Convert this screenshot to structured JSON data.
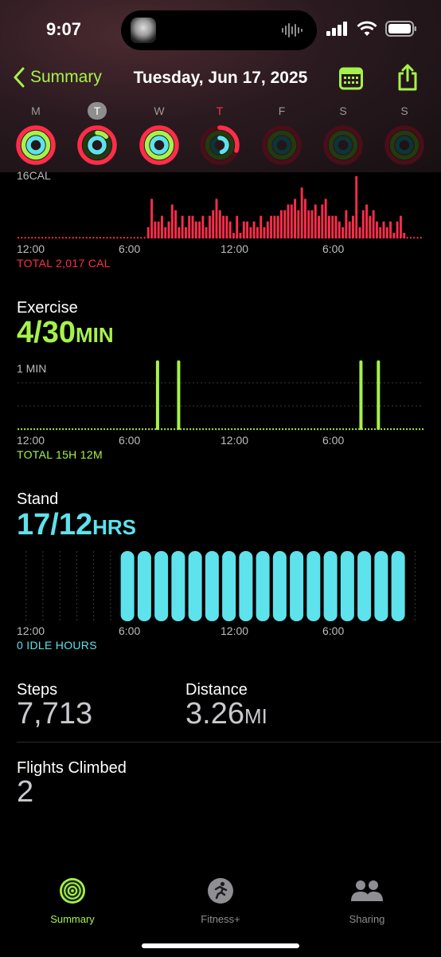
{
  "status_bar": {
    "time": "9:07"
  },
  "nav": {
    "back_label": "Summary",
    "title": "Tuesday, Jun 17, 2025"
  },
  "week": [
    {
      "letter": "M",
      "state": "normal",
      "move": 1.0,
      "exercise": 1.0,
      "stand": 1.0
    },
    {
      "letter": "T",
      "state": "selected",
      "move": 1.0,
      "exercise": 0.13,
      "stand": 1.0
    },
    {
      "letter": "W",
      "state": "normal",
      "move": 1.0,
      "exercise": 1.0,
      "stand": 1.0
    },
    {
      "letter": "T",
      "state": "today",
      "move": 0.3,
      "exercise": 0.0,
      "stand": 0.45
    },
    {
      "letter": "F",
      "state": "normal",
      "move": 0,
      "exercise": 0,
      "stand": 0
    },
    {
      "letter": "S",
      "state": "normal",
      "move": 0,
      "exercise": 0,
      "stand": 0
    },
    {
      "letter": "S",
      "state": "normal",
      "move": 0,
      "exercise": 0,
      "stand": 0
    }
  ],
  "move": {
    "y_max_label": "16CAL",
    "total": "TOTAL 2,017 CAL",
    "color": "#ff2d4a",
    "ticks": [
      "12:00",
      "6:00",
      "12:00",
      "6:00"
    ],
    "bars": [
      0,
      0,
      0,
      0,
      0,
      0,
      0,
      0,
      0,
      0,
      0,
      0,
      0,
      0,
      0,
      0,
      0,
      0,
      0,
      0,
      0,
      0,
      0,
      0,
      0,
      0,
      0,
      0,
      0,
      0,
      0,
      0,
      0,
      0,
      0,
      0,
      0,
      0,
      2,
      7,
      3,
      3,
      4,
      2,
      3,
      6,
      5,
      2,
      4,
      2,
      4,
      4,
      3,
      3,
      4,
      2,
      4,
      5,
      7,
      5,
      4,
      4,
      3,
      1,
      4,
      1,
      3,
      3,
      2,
      3,
      2,
      4,
      2,
      3,
      4,
      4,
      4,
      5,
      5,
      6,
      6,
      7,
      5,
      9,
      7,
      5,
      5,
      6,
      4,
      6,
      7,
      4,
      4,
      4,
      3,
      2,
      5,
      3,
      4,
      11,
      2,
      5,
      6,
      4,
      5,
      3,
      2,
      3,
      2,
      3,
      1,
      3,
      4,
      1,
      0,
      0,
      0,
      0,
      0
    ]
  },
  "exercise": {
    "title": "Exercise",
    "value": "4/30",
    "unit": "MIN",
    "y_max_label": "1 MIN",
    "total": "TOTAL 15H 12M",
    "color": "#a6f24a",
    "ticks": [
      "12:00",
      "6:00",
      "12:00",
      "6:00"
    ],
    "active_minutes_at": [
      0.341,
      0.393,
      0.842,
      0.885
    ]
  },
  "stand": {
    "title": "Stand",
    "value": "17/12",
    "unit": "HRS",
    "total": "0 IDLE HOURS",
    "color": "#5ee2ec",
    "ticks": [
      "12:00",
      "6:00",
      "12:00",
      "6:00"
    ],
    "hours": [
      0,
      0,
      0,
      0,
      0,
      0,
      1,
      1,
      1,
      1,
      1,
      1,
      1,
      1,
      1,
      1,
      1,
      1,
      1,
      1,
      1,
      1,
      1,
      0
    ]
  },
  "steps": {
    "label": "Steps",
    "value": "7,713"
  },
  "distance": {
    "label": "Distance",
    "value": "3.26",
    "unit": "MI"
  },
  "flights": {
    "label": "Flights Climbed",
    "value": "2"
  },
  "tabs": [
    {
      "label": "Summary",
      "icon": "activity-rings-icon",
      "active": true
    },
    {
      "label": "Fitness+",
      "icon": "running-figure-icon",
      "active": false
    },
    {
      "label": "Sharing",
      "icon": "people-icon",
      "active": false
    }
  ]
}
